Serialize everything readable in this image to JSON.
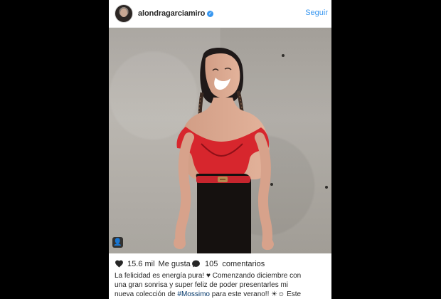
{
  "header": {
    "username": "alondragarciamiro",
    "follow_label": "Seguir"
  },
  "post": {
    "likes_count": "15.6 mil",
    "likes_label": "Me gusta",
    "comments_count": "105",
    "comments_label": "comentarios"
  },
  "caption": {
    "line1": "La felicidad es energía pura! ♥ Comenzando diciembre con",
    "line2": "una gran sonrisa y super feliz de poder presentarles mi",
    "line3_prefix": "nueva colección de ",
    "hashtag": "#Mossimo",
    "line3_suffix": " para este verano!! ☀☺ Este"
  },
  "icons": {
    "avatar": "avatar",
    "verified": "verified-badge-icon",
    "like": "heart-icon",
    "comment": "comment-bubble-icon",
    "photo_tag": "user-tag-icon"
  },
  "colors": {
    "brand_blue": "#3897f0",
    "text": "#262626",
    "hashtag": "#003569",
    "backdrop": "#000000"
  }
}
